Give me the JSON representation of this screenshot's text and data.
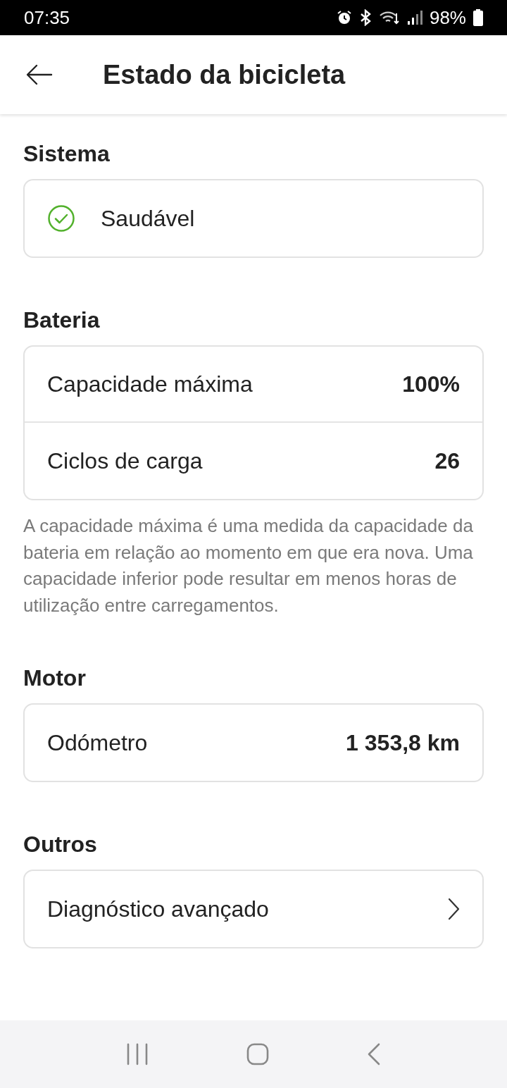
{
  "status_bar": {
    "time": "07:35",
    "battery": "98%"
  },
  "header": {
    "title": "Estado da bicicleta"
  },
  "sections": [
    {
      "title": "Sistema",
      "rows": [
        {
          "kind": "status",
          "label": "Saudável"
        }
      ]
    },
    {
      "title": "Bateria",
      "rows": [
        {
          "kind": "value",
          "label": "Capacidade máxima",
          "value": "100%"
        },
        {
          "kind": "value",
          "label": "Ciclos de carga",
          "value": "26"
        }
      ],
      "note": "A capacidade máxima é uma medida da capacidade da bateria em relação ao momento em que era nova. Uma capacidade inferior pode resultar em menos horas de utilização entre carregamentos."
    },
    {
      "title": "Motor",
      "rows": [
        {
          "kind": "value",
          "label": "Odómetro",
          "value": "1 353,8 km"
        }
      ]
    },
    {
      "title": "Outros",
      "rows": [
        {
          "kind": "link",
          "label": "Diagnóstico avançado"
        }
      ]
    }
  ]
}
